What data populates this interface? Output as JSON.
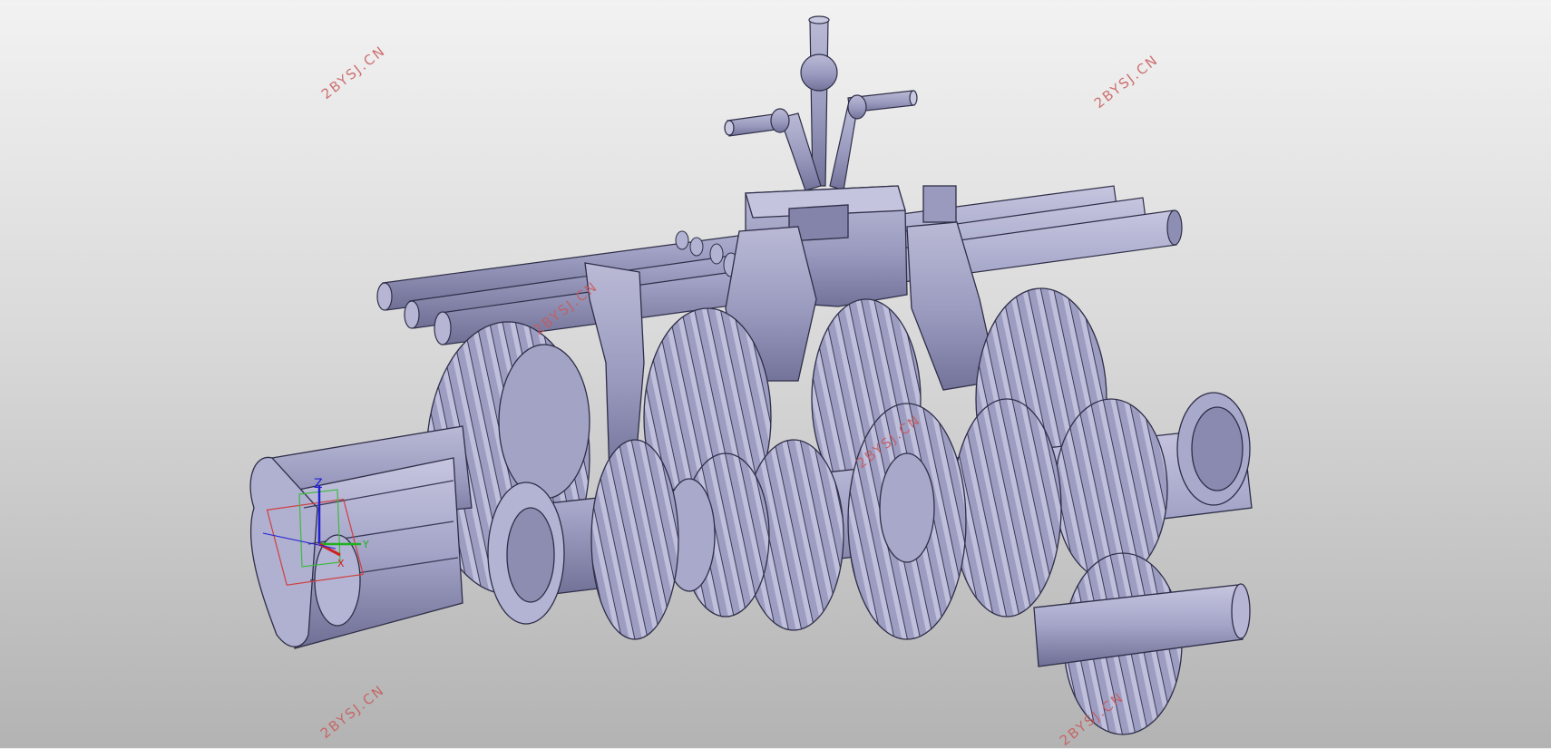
{
  "watermarks": [
    "2BYSJ.CN",
    "2BYSJ.CN",
    "2BYSJ.CN",
    "2BYSJ.CN",
    "2BYSJ.CN",
    "2BYSJ.CN"
  ],
  "axis_triad": {
    "z_label": "Z",
    "y_label": "Y",
    "x_label": "X"
  },
  "colors": {
    "part_fill": "#a3a3c6",
    "part_shade": "#7c7ca2",
    "part_light": "#c4c4de",
    "edge": "#2e2e48",
    "watermark": "#c85a5a"
  }
}
